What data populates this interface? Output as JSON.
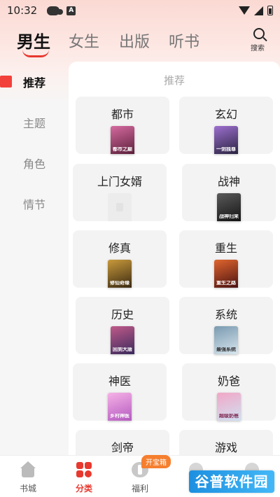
{
  "status_bar": {
    "time": "10:32",
    "a_icon": "A"
  },
  "top_tabs": [
    {
      "label": "男生",
      "active": true
    },
    {
      "label": "女生",
      "active": false
    },
    {
      "label": "出版",
      "active": false
    },
    {
      "label": "听书",
      "active": false
    }
  ],
  "search": {
    "label": "搜索"
  },
  "side_nav": [
    {
      "label": "推荐",
      "active": true
    },
    {
      "label": "主题",
      "active": false
    },
    {
      "label": "角色",
      "active": false
    },
    {
      "label": "情节",
      "active": false
    }
  ],
  "panel": {
    "title": "推荐",
    "genres": [
      {
        "label": "都市",
        "cover_text": "都市之巅",
        "colors": [
          "#5b1f3a",
          "#d66aa0"
        ]
      },
      {
        "label": "玄幻",
        "cover_text": "一剑独尊",
        "colors": [
          "#2a2440",
          "#9d6fd0"
        ]
      },
      {
        "label": "上门女婿",
        "cover_text": "",
        "colors": []
      },
      {
        "label": "战神",
        "cover_text": "战神归来",
        "colors": [
          "#141414",
          "#5a5a5a"
        ]
      },
      {
        "label": "修真",
        "cover_text": "修仙奇缘",
        "colors": [
          "#3a2a12",
          "#c99a3c"
        ]
      },
      {
        "label": "重生",
        "cover_text": "重生之路",
        "colors": [
          "#4a1212",
          "#e0652e"
        ]
      },
      {
        "label": "历史",
        "cover_text": "回到大唐",
        "colors": [
          "#3a2a5c",
          "#c05a8a"
        ]
      },
      {
        "label": "系统",
        "cover_text": "最强系统",
        "colors": [
          "#d8e6ee",
          "#7a9ab0"
        ]
      },
      {
        "label": "神医",
        "cover_text": "乡村神医",
        "colors": [
          "#b45ac0",
          "#f6b2e6"
        ]
      },
      {
        "label": "奶爸",
        "cover_text": "超级奶爸",
        "colors": [
          "#cfe1f2",
          "#f2a6c6"
        ]
      },
      {
        "label": "剑帝",
        "cover_text": "",
        "colors": []
      },
      {
        "label": "游戏",
        "cover_text": "",
        "colors": []
      }
    ]
  },
  "bottom_nav": [
    {
      "label": "书城",
      "icon": "house-icon",
      "active": false
    },
    {
      "label": "分类",
      "icon": "grid-icon",
      "active": true
    },
    {
      "label": "福利",
      "icon": "gift-icon",
      "active": false
    }
  ],
  "welfare_badge": "开宝箱",
  "watermark": "谷普软件园",
  "colors": {
    "accent": "#e8392f",
    "badge": "#f57f2f"
  }
}
